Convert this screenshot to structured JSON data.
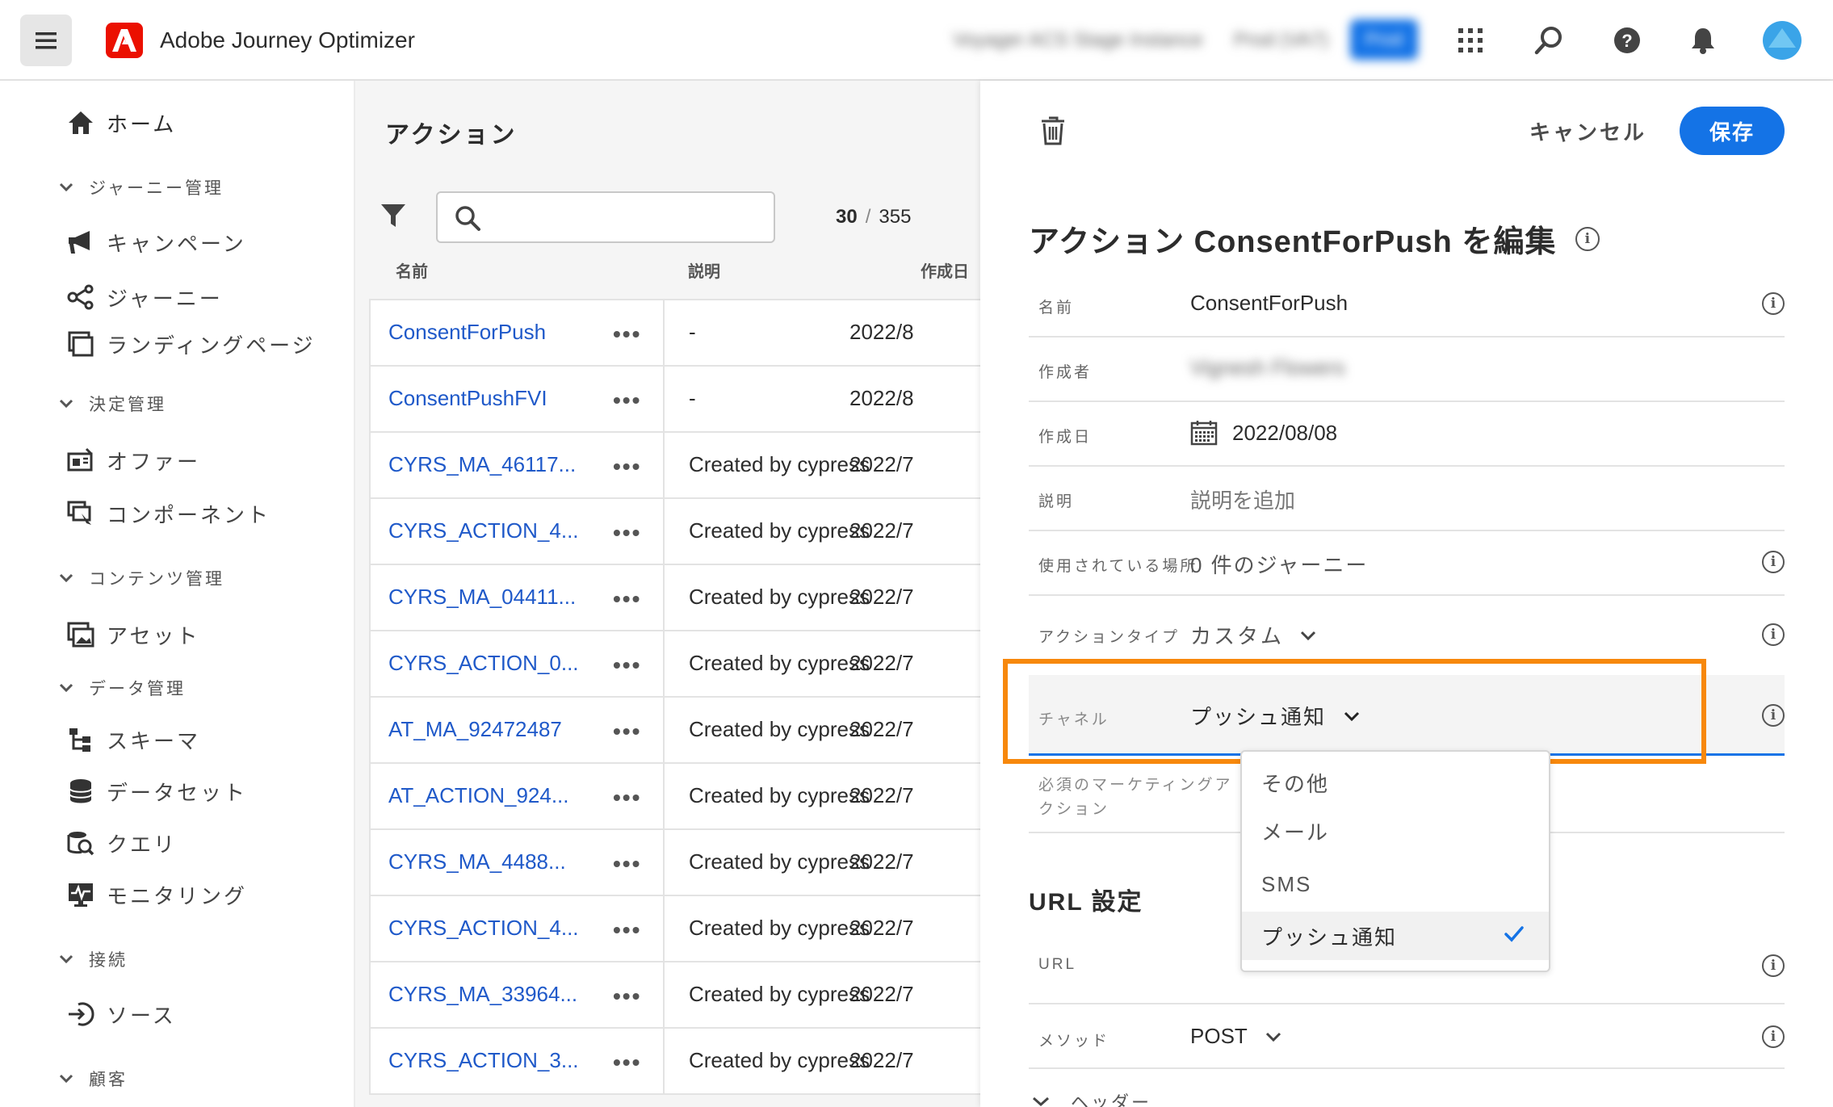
{
  "app": {
    "title": "Adobe Journey Optimizer",
    "sandbox_label": "Voyager ACS Stage Instance",
    "env_label": "Prod (VA7)",
    "env_badge": "Prod"
  },
  "colors": {
    "accent": "#1473e6",
    "link": "#1f59c9",
    "adobe_red": "#eb1000",
    "highlight": "#f7880c"
  },
  "nav": {
    "home": "ホーム",
    "sections": [
      {
        "label": "ジャーニー管理",
        "items": [
          "キャンペーン",
          "ジャーニー",
          "ランディングページ"
        ]
      },
      {
        "label": "決定管理",
        "items": [
          "オファー",
          "コンポーネント"
        ]
      },
      {
        "label": "コンテンツ管理",
        "items": [
          "アセット"
        ]
      },
      {
        "label": "データ管理",
        "items": [
          "スキーマ",
          "データセット",
          "クエリ",
          "モニタリング"
        ]
      },
      {
        "label": "接続",
        "items": [
          "ソース"
        ]
      },
      {
        "label": "顧客",
        "items": []
      }
    ]
  },
  "list": {
    "title": "アクション",
    "search_placeholder": "",
    "count_shown": "30",
    "count_sep": "/",
    "count_total": "355",
    "columns": {
      "name": "名前",
      "description": "説明",
      "created": "作成日"
    },
    "more_label": "•••",
    "rows": [
      {
        "name": "ConsentForPush",
        "desc": "-",
        "date": "2022/8"
      },
      {
        "name": "ConsentPushFVI",
        "desc": "-",
        "date": "2022/8"
      },
      {
        "name": "CYRS_MA_46117...",
        "desc": "Created by cypress M",
        "date": "2022/7"
      },
      {
        "name": "CYRS_ACTION_4...",
        "desc": "Created by cypress E",
        "date": "2022/7"
      },
      {
        "name": "CYRS_MA_04411...",
        "desc": "Created by cypress M",
        "date": "2022/7"
      },
      {
        "name": "CYRS_ACTION_0...",
        "desc": "Created by cypress E",
        "date": "2022/7"
      },
      {
        "name": "AT_MA_92472487",
        "desc": "Created by cypress M",
        "date": "2022/7"
      },
      {
        "name": "AT_ACTION_924...",
        "desc": "Created by cypress E",
        "date": "2022/7"
      },
      {
        "name": "CYRS_MA_4488...",
        "desc": "Created by cypress M",
        "date": "2022/7"
      },
      {
        "name": "CYRS_ACTION_4...",
        "desc": "Created by cypress E",
        "date": "2022/7"
      },
      {
        "name": "CYRS_MA_33964...",
        "desc": "Created by cypress M",
        "date": "2022/7"
      },
      {
        "name": "CYRS_ACTION_3...",
        "desc": "Created by cypress E",
        "date": "2022/7"
      }
    ]
  },
  "panel": {
    "cancel": "キャンセル",
    "save": "保存",
    "title": "アクション ConsentForPush を編集",
    "fields": {
      "name_label": "名前",
      "name_value": "ConsentForPush",
      "author_label": "作成者",
      "author_value": "Vignesh Flowers",
      "created_label": "作成日",
      "created_value": "2022/08/08",
      "desc_label": "説明",
      "desc_placeholder": "説明を追加",
      "usage_label": "使用されている場所",
      "usage_value": "0 件のジャーニー",
      "type_label": "アクションタイプ",
      "type_value": "カスタム",
      "channel_label": "チャネル",
      "channel_value": "プッシュ通知",
      "marketing_label_1": "必須のマーケティングア",
      "marketing_label_2": "クション"
    },
    "url_section": "URL 設定",
    "url_label": "URL",
    "method_label": "メソッド",
    "method_value": "POST",
    "header_section": "ヘッダー"
  },
  "channel_dropdown": {
    "options": [
      "その他",
      "メール",
      "SMS",
      "プッシュ通知"
    ],
    "selected": "プッシュ通知"
  }
}
